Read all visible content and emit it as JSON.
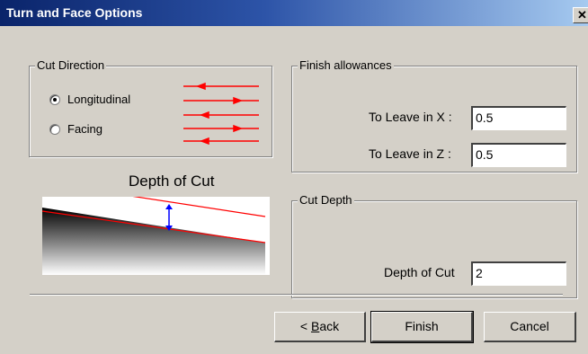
{
  "window": {
    "title": "Turn and Face Options",
    "close_glyph": "✕"
  },
  "cut_direction": {
    "label": "Cut Direction",
    "options": [
      {
        "label": "Longitudinal",
        "selected": true
      },
      {
        "label": "Facing",
        "selected": false
      }
    ],
    "arrow_color": "#ff0000"
  },
  "diagram": {
    "label": "Depth of Cut",
    "label_color": "#0000ff",
    "line_color": "#ff0000"
  },
  "finish_allowances": {
    "label": "Finish allowances",
    "x_label": "To Leave in X :",
    "x_value": "0.5",
    "z_label": "To Leave in Z :",
    "z_value": "0.5"
  },
  "cut_depth": {
    "label": "Cut Depth",
    "depth_label": "Depth of Cut",
    "depth_value": "2"
  },
  "buttons": {
    "back_prefix": "< ",
    "back_mnemonic": "B",
    "back_rest": "ack",
    "finish": "Finish",
    "cancel": "Cancel"
  }
}
